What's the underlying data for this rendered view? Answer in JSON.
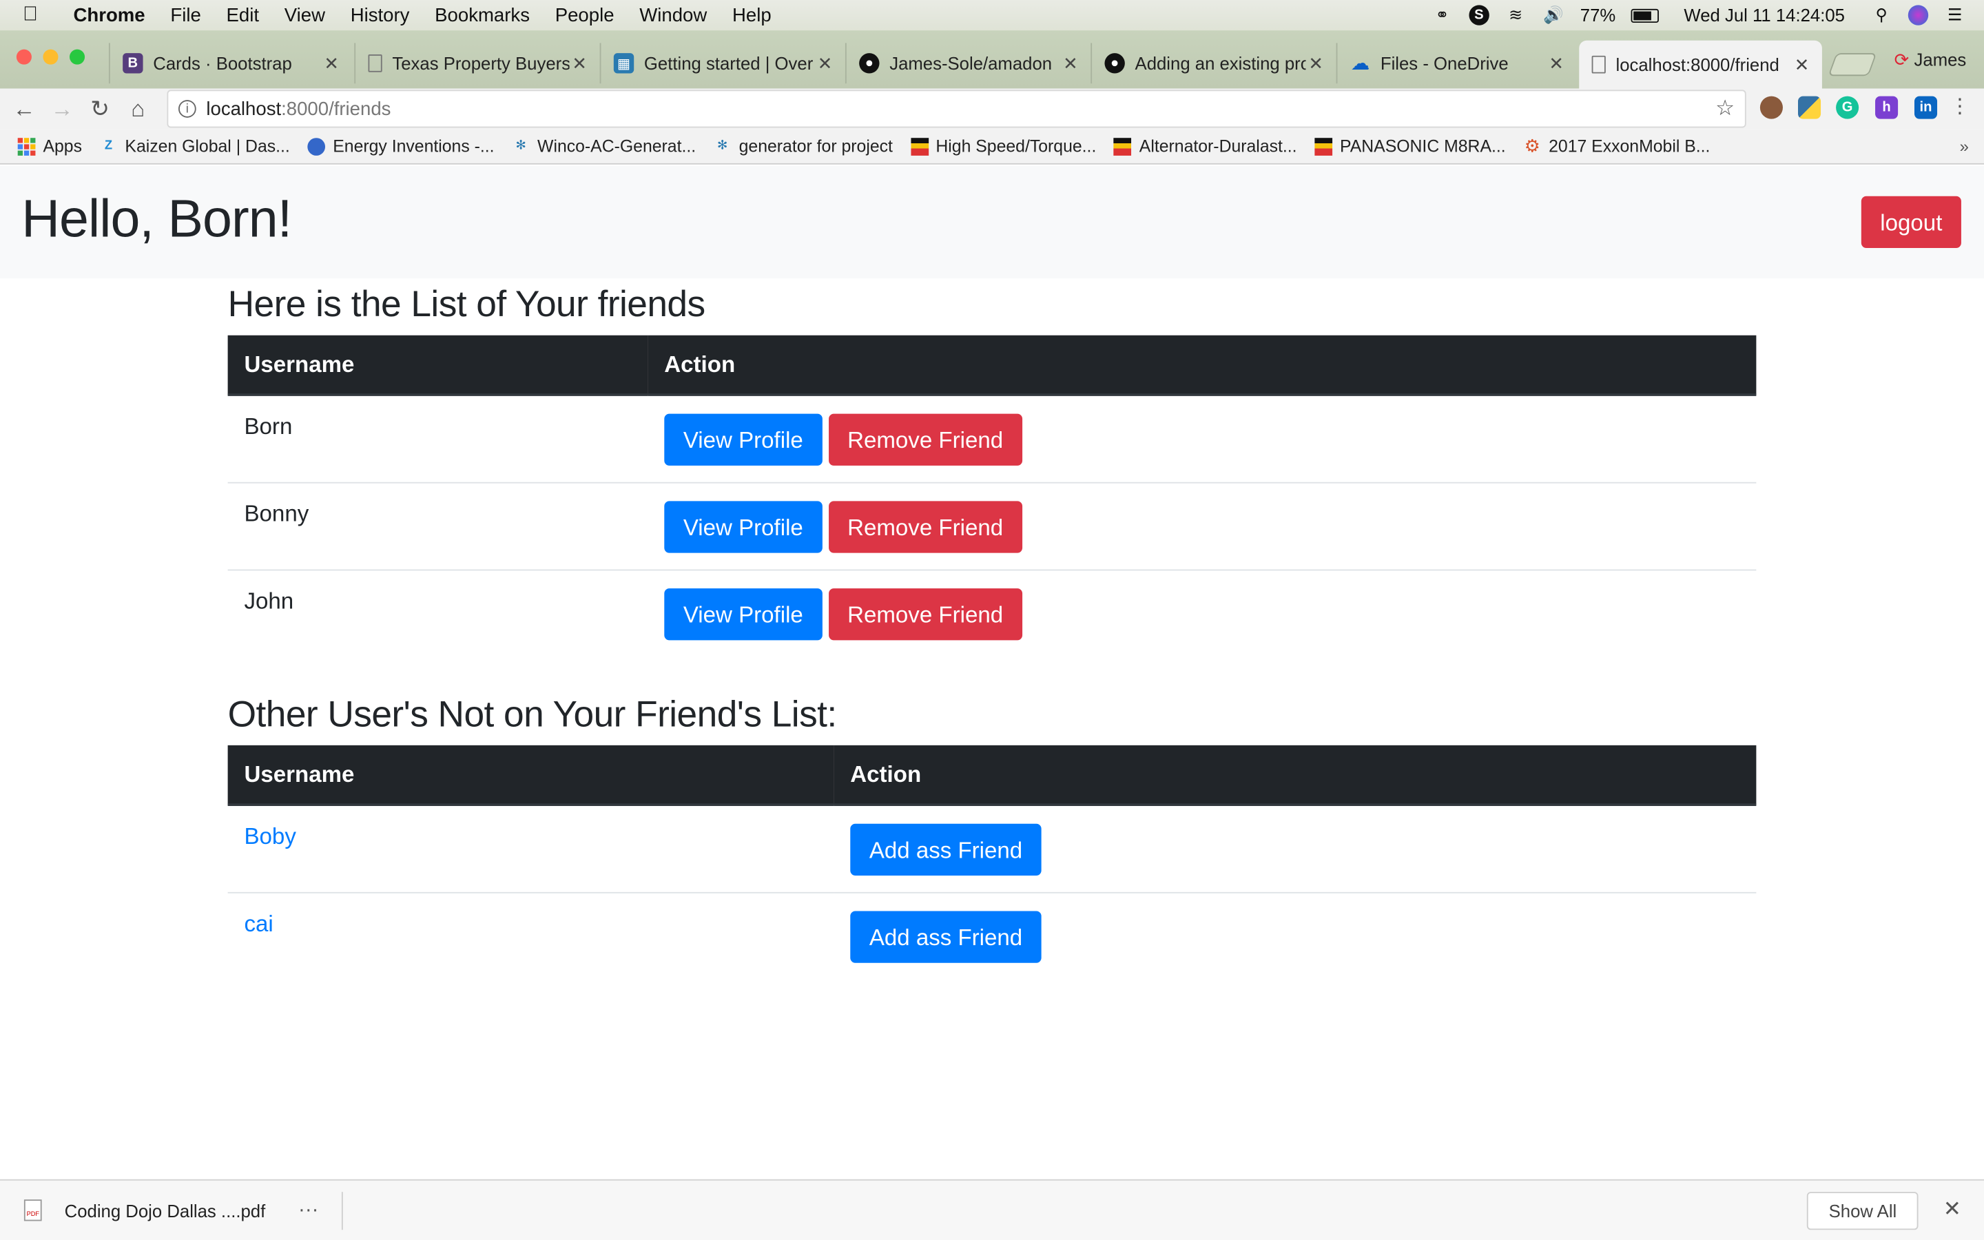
{
  "menubar": {
    "app": "Chrome",
    "items": [
      "File",
      "Edit",
      "View",
      "History",
      "Bookmarks",
      "People",
      "Window",
      "Help"
    ],
    "battery": "77%",
    "datetime": "Wed Jul 11  14:24:05"
  },
  "tabs": [
    {
      "title": "Cards · Bootstrap",
      "icon": "bootstrap-icon",
      "color": "#563d7c"
    },
    {
      "title": "Texas Property Buyers",
      "icon": "page-icon",
      "color": "#888888"
    },
    {
      "title": "Getting started | Over",
      "icon": "docs-icon",
      "color": "#2a7ab0"
    },
    {
      "title": "James-Sole/amadon",
      "icon": "github-icon",
      "color": "#111111"
    },
    {
      "title": "Adding an existing pro",
      "icon": "github-icon",
      "color": "#111111"
    },
    {
      "title": "Files - OneDrive",
      "icon": "onedrive-icon",
      "color": "#0a5fc7"
    },
    {
      "title": "localhost:8000/friend",
      "icon": "page-icon",
      "color": "#888888",
      "active": true
    }
  ],
  "profile": "James",
  "address": {
    "host": "localhost",
    "path": ":8000/friends"
  },
  "bookmarks": [
    {
      "label": "Apps",
      "icon": "apps-grid-icon"
    },
    {
      "label": "Kaizen Global | Das...",
      "icon": "kaizen-icon"
    },
    {
      "label": "Energy Inventions -...",
      "icon": "globe-icon"
    },
    {
      "label": "Winco-AC-Generat...",
      "icon": "generator-icon"
    },
    {
      "label": "generator for project",
      "icon": "generator-icon"
    },
    {
      "label": "High Speed/Torque...",
      "icon": "store-icon"
    },
    {
      "label": "Alternator-Duralast...",
      "icon": "store-icon"
    },
    {
      "label": "PANASONIC M8RA...",
      "icon": "store-icon"
    },
    {
      "label": "2017 ExxonMobil B...",
      "icon": "gear-icon"
    }
  ],
  "page": {
    "greeting": "Hello, Born!",
    "logout": "logout",
    "friends_title": "Here is the List of Your friends",
    "friends_headers": [
      "Username",
      "Action"
    ],
    "friends": [
      {
        "username": "Born",
        "view": "View Profile",
        "remove": "Remove Friend"
      },
      {
        "username": "Bonny",
        "view": "View Profile",
        "remove": "Remove Friend"
      },
      {
        "username": "John",
        "view": "View Profile",
        "remove": "Remove Friend"
      }
    ],
    "others_title": "Other User's Not on Your Friend's List:",
    "others_headers": [
      "Username",
      "Action"
    ],
    "others": [
      {
        "username": "Boby",
        "add": "Add ass Friend"
      },
      {
        "username": "cai",
        "add": "Add ass Friend"
      }
    ]
  },
  "downloads": {
    "file": "Coding Dojo Dallas ....pdf",
    "more": "···",
    "show_all": "Show All"
  },
  "colors": {
    "primary": "#007bff",
    "danger": "#dc3545",
    "table_head": "#212529"
  }
}
